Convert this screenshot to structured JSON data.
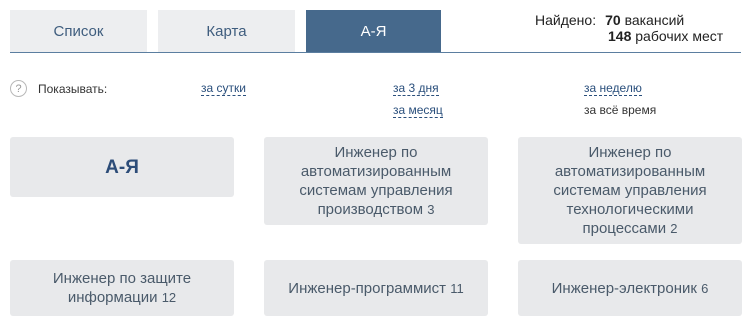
{
  "tabs": {
    "list": "Список",
    "map": "Карта",
    "az": "А-Я"
  },
  "found": {
    "label": "Найдено:",
    "vacancies_count": "70",
    "vacancies_word": "вакансий",
    "places_count": "148",
    "places_word": "рабочих мест"
  },
  "filter": {
    "help": "?",
    "label": "Показывать:",
    "periods": {
      "day": "за сутки",
      "three_days": "за 3 дня",
      "week": "за неделю",
      "month": "за месяц",
      "all_time": "за всё время"
    }
  },
  "cards": {
    "az": "А-Я",
    "c1": {
      "title": "Инженер по автоматизированным системам управления производством",
      "count": "3"
    },
    "c2": {
      "title": "Инженер по автоматизированным системам управления технологическими процессами",
      "count": "2"
    },
    "c3": {
      "title": "Инженер по защите информации",
      "count": "12"
    },
    "c4": {
      "title": "Инженер-программист",
      "count": "11"
    },
    "c5": {
      "title": "Инженер-электроник",
      "count": "6"
    }
  },
  "colors": {
    "active_tab": "#46698c",
    "inactive_tab": "#edeef0",
    "link": "#2a4f7c",
    "card_bg": "#e8e9eb"
  }
}
